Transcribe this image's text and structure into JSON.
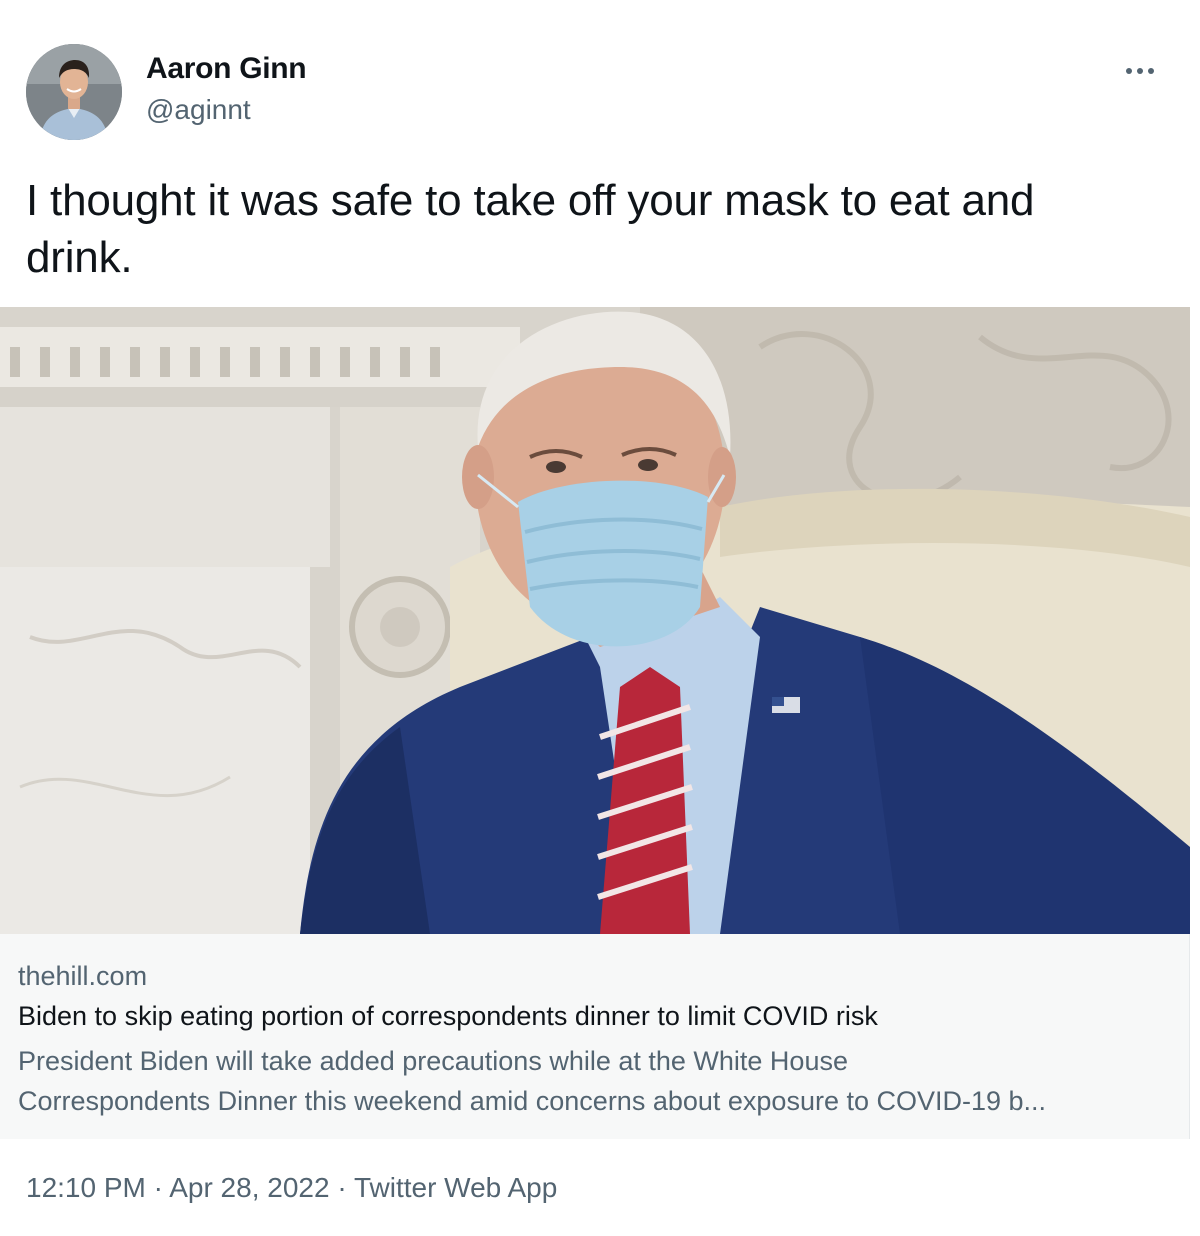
{
  "author": {
    "display_name": "Aaron Ginn",
    "handle": "@aginnt",
    "avatar_icon": "profile-photo"
  },
  "more_icon": "ellipsis-icon",
  "tweet": {
    "text_line1": "I thought it was safe to take off your mask to eat and",
    "text_line2": "drink."
  },
  "card": {
    "image_alt": "photo",
    "domain": "thehill.com",
    "title": "Biden to skip eating portion of correspondents dinner to limit COVID risk",
    "description_line1": "President Biden will take added precautions while at the White House",
    "description_line2": "Correspondents Dinner this weekend amid concerns about exposure to COVID-19 b..."
  },
  "meta": {
    "time": "12:10 PM",
    "separator": "·",
    "date": "Apr 28, 2022",
    "source": "Twitter Web App"
  },
  "colors": {
    "primary_text": "#0f1419",
    "secondary_text": "#536471",
    "card_background": "#f7f8f8"
  }
}
